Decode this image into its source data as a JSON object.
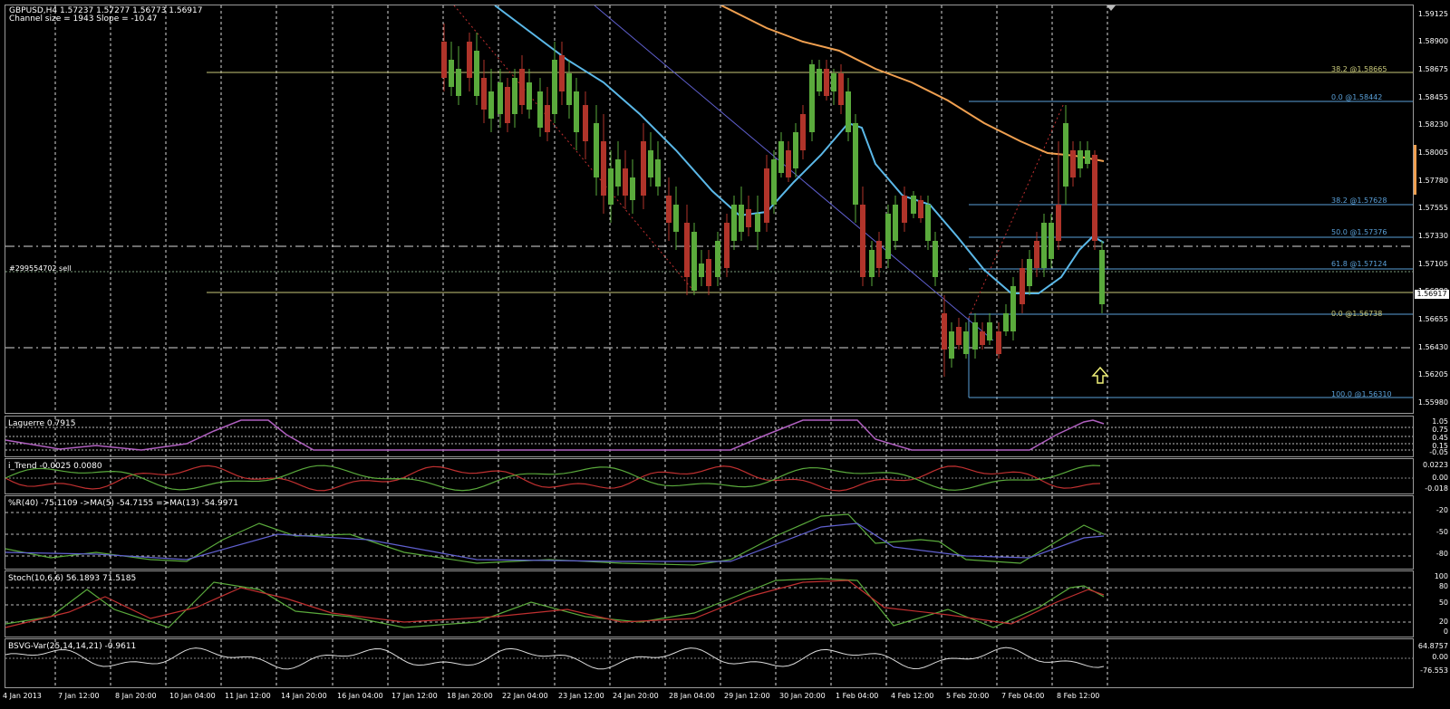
{
  "symbol_header": "GBPUSD,H4  1.57237 1.57277 1.56773 1.56917",
  "channel_info": "Channel size = 1943 Slope = -10.47",
  "order_label": "#299554702 sell",
  "current_price": "1.56917",
  "price_scale": [
    "1.59125",
    "1.58900",
    "1.58675",
    "1.58455",
    "1.58230",
    "1.58005",
    "1.57780",
    "1.57555",
    "1.57330",
    "1.57105",
    "1.56880",
    "1.56655",
    "1.56430",
    "1.56205",
    "1.55980"
  ],
  "fib_levels": [
    {
      "label": "38.2 @1.58665",
      "color": "#c8c87a"
    },
    {
      "label": "0.0 @1.58442",
      "color": "#5aa0d8"
    },
    {
      "label": "38.2 @1.57628",
      "color": "#5aa0d8"
    },
    {
      "label": "50.0 @1.57376",
      "color": "#5aa0d8"
    },
    {
      "label": "61.8 @1.57124",
      "color": "#5aa0d8"
    },
    {
      "label": "0.0 @1.56738",
      "color": "#c8c87a"
    },
    {
      "label": "100.0 @1.56310",
      "color": "#5aa0d8"
    }
  ],
  "indicators": {
    "laguerre": {
      "title": "Laguerre 0.7915",
      "scale": [
        "1.05",
        "0.75",
        "0.45",
        "0.15",
        "-0.05"
      ]
    },
    "itrend": {
      "title": "i_Trend -0.0025 0.0080",
      "scale": [
        "0.0223",
        "0.00",
        "-0.018"
      ]
    },
    "wpr": {
      "title": "%R(40) -75.1109  ->MA(5) -54.7155  =>MA(13) -54.9971",
      "scale": [
        "-20",
        "-50",
        "-80"
      ]
    },
    "stoch": {
      "title": "Stoch(10,6,6) 56.1893 71.5185",
      "scale": [
        "100",
        "80",
        "50",
        "20",
        "0"
      ]
    },
    "bsvg": {
      "title": "BSVG-Var(25,14,14,21) -0.9611",
      "scale": [
        "64.8757",
        "0.00",
        "-76.553"
      ]
    }
  },
  "date_axis": [
    "4 Jan 2013",
    "7 Jan 12:00",
    "8 Jan 20:00",
    "10 Jan 04:00",
    "11 Jan 12:00",
    "14 Jan 20:00",
    "16 Jan 04:00",
    "17 Jan 12:00",
    "18 Jan 20:00",
    "22 Jan 04:00",
    "23 Jan 12:00",
    "24 Jan 20:00",
    "28 Jan 04:00",
    "29 Jan 12:00",
    "30 Jan 20:00",
    "1 Feb 04:00",
    "4 Feb 12:00",
    "5 Feb 20:00",
    "7 Feb 04:00",
    "8 Feb 12:00"
  ],
  "colors": {
    "bull": "#5aaa3c",
    "bear": "#b0342a",
    "ma_fast": "#5bb8e8",
    "ma_slow": "#f0a050",
    "fib_blue": "#5aa0d8",
    "fib_yellow": "#c8c87a",
    "arrow": "#f0f078"
  },
  "icons": [
    "up-arrow-icon",
    "scroll-marker-icon"
  ]
}
